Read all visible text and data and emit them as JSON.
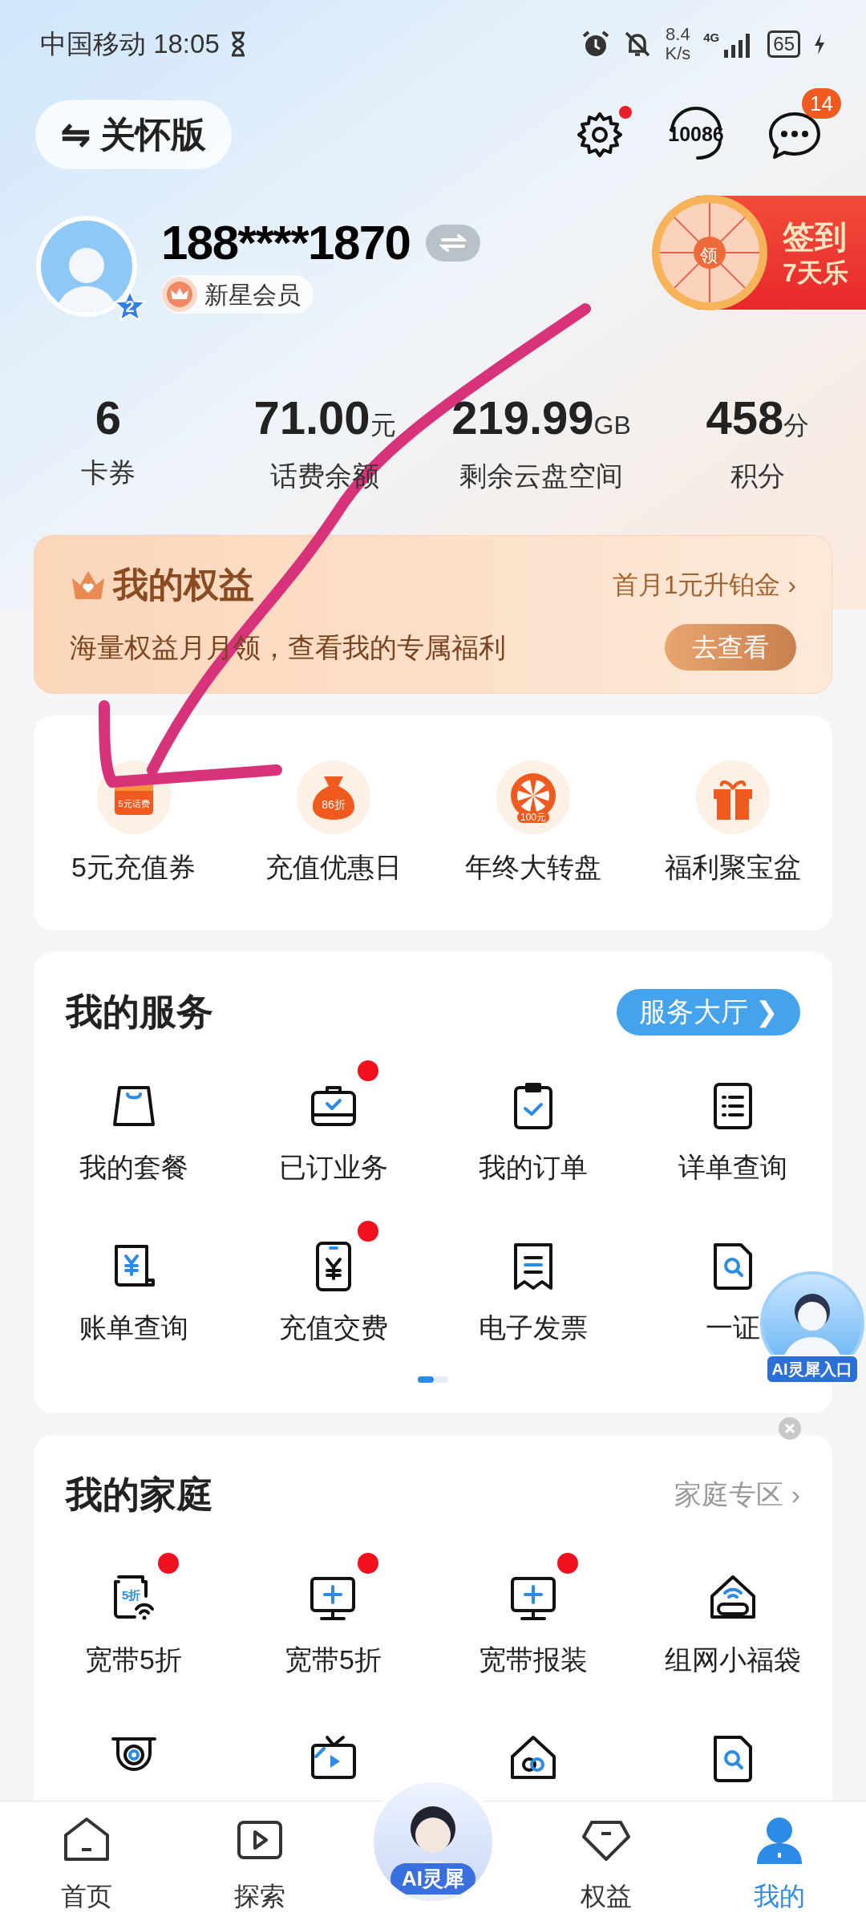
{
  "status_bar": {
    "carrier_time": "中国移动 18:05",
    "speed": "8.4",
    "speed_unit": "K/s",
    "network": "4G",
    "battery": "65"
  },
  "header": {
    "care_mode": "⇋ 关怀版",
    "settings_dot": true,
    "hotline": "10086",
    "message_badge": "14"
  },
  "profile": {
    "phone": "188****1870",
    "level_badge": "2",
    "member": "新星会员",
    "signin_top": "签到",
    "signin_bottom": "7天乐",
    "wheel_label": "领"
  },
  "stats": [
    {
      "value": "6",
      "label": "卡券"
    },
    {
      "value": "71.00",
      "unit": "元",
      "label": "话费余额"
    },
    {
      "value": "219.99",
      "unit": "GB",
      "label": "剩余云盘空间"
    },
    {
      "value": "458",
      "unit": "分",
      "label": "积分"
    }
  ],
  "benefits": {
    "title": "我的权益",
    "promo": "首月1元升铂金 ›",
    "desc": "海量权益月月领，查看我的专属福利",
    "button": "去查看"
  },
  "quick": [
    {
      "kind": "voucher",
      "label": "5元充值券",
      "icon_text": "5元话费"
    },
    {
      "kind": "bag",
      "label": "充值优惠日",
      "icon_text": "86折"
    },
    {
      "kind": "wheel",
      "label": "年终大转盘",
      "icon_text": "100元"
    },
    {
      "kind": "gift",
      "label": "福利聚宝盆"
    }
  ],
  "services": {
    "title": "我的服务",
    "link": "服务大厅 ❯",
    "items": [
      {
        "kind": "bag",
        "label": "我的套餐",
        "dot": false
      },
      {
        "kind": "case",
        "label": "已订业务",
        "dot": true
      },
      {
        "kind": "clipboard",
        "label": "我的订单",
        "dot": false
      },
      {
        "kind": "list",
        "label": "详单查询",
        "dot": false
      },
      {
        "kind": "bill",
        "label": "账单查询",
        "dot": false
      },
      {
        "kind": "phone",
        "label": "充值交费",
        "dot": true
      },
      {
        "kind": "receipt",
        "label": "电子发票",
        "dot": false
      },
      {
        "kind": "search",
        "label": "一证",
        "dot": false
      }
    ]
  },
  "ai_float": {
    "label": "AI灵犀入口"
  },
  "family": {
    "title": "我的家庭",
    "link": "家庭专区 ›",
    "items": [
      {
        "kind": "router",
        "label": "宽带5折",
        "dot": true,
        "icon_text": "5折"
      },
      {
        "kind": "monitor",
        "label": "宽带5折",
        "dot": true
      },
      {
        "kind": "monitor",
        "label": "宽带报装",
        "dot": true
      },
      {
        "kind": "home",
        "label": "组网小福袋",
        "dot": false
      },
      {
        "kind": "camera",
        "dot": false
      },
      {
        "kind": "tv",
        "dot": false
      },
      {
        "kind": "house",
        "dot": false
      },
      {
        "kind": "search",
        "dot": false
      }
    ]
  },
  "bottom_nav": [
    {
      "kind": "home",
      "label": "首页",
      "selected": false
    },
    {
      "kind": "play",
      "label": "探索",
      "selected": false
    },
    {
      "kind": "ai",
      "label": "AI灵犀",
      "selected": false
    },
    {
      "kind": "gem",
      "label": "权益",
      "selected": false
    },
    {
      "kind": "user",
      "label": "我的",
      "selected": true
    }
  ]
}
